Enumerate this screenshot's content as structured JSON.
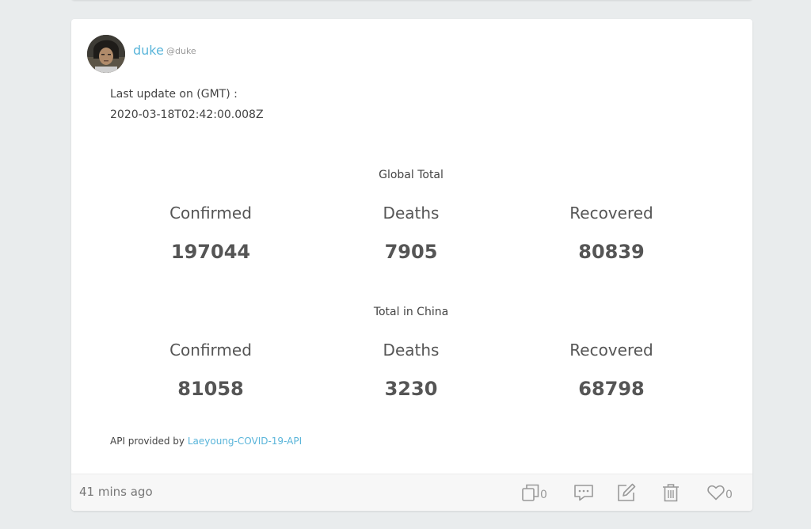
{
  "post": {
    "author": {
      "name": "duke",
      "handle": "@duke"
    },
    "update_label": "Last update on (GMT) :",
    "update_time": "2020-03-18T02:42:00.008Z",
    "global": {
      "title": "Global Total",
      "confirmed_label": "Confirmed",
      "confirmed": "197044",
      "deaths_label": "Deaths",
      "deaths": "7905",
      "recovered_label": "Recovered",
      "recovered": "80839"
    },
    "china": {
      "title": "Total in China",
      "confirmed_label": "Confirmed",
      "confirmed": "81058",
      "deaths_label": "Deaths",
      "deaths": "3230",
      "recovered_label": "Recovered",
      "recovered": "68798"
    },
    "api_prefix": "API provided by",
    "api_link": "Laeyoung-COVID-19-API"
  },
  "footer": {
    "time_ago": "41 mins ago",
    "repost_count": "0",
    "like_count": "0",
    "icons": {
      "repost": "repost-icon",
      "comment": "comment-icon",
      "edit": "edit-icon",
      "delete": "trash-icon",
      "like": "heart-icon"
    }
  },
  "colors": {
    "link": "#5ab5da",
    "page_background": "#e9eced",
    "card_background": "#ffffff",
    "footer_background": "#f7f7f7",
    "icon": "#999999"
  }
}
